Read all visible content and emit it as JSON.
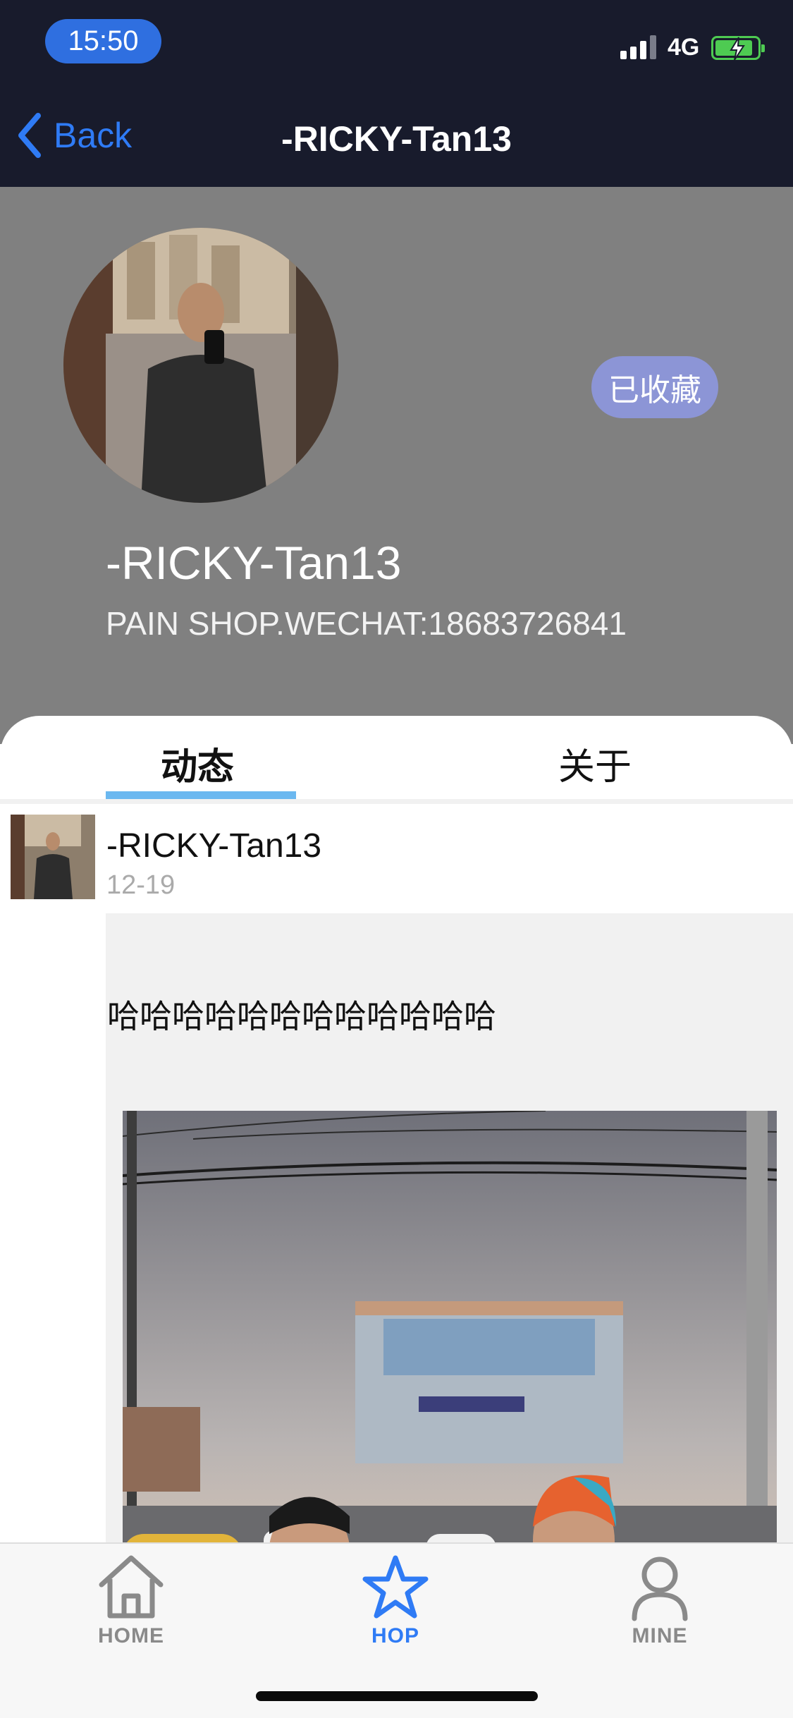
{
  "status_bar": {
    "time": "15:50",
    "network": "4G",
    "battery_color": "#4ecb52"
  },
  "nav": {
    "back_label": "Back",
    "title": "-RICKY-Tan13",
    "accent": "#2f7bf5"
  },
  "profile": {
    "name": "-RICKY-Tan13",
    "bio": "PAIN SHOP.WECHAT:18683726841",
    "favorite_button": "已收藏",
    "header_bg": "#808080"
  },
  "tabs": [
    {
      "label": "动态",
      "active": true
    },
    {
      "label": "关于",
      "active": false
    }
  ],
  "post": {
    "author": "-RICKY-Tan13",
    "date": "12-19",
    "text": "哈哈哈哈哈哈哈哈哈哈哈哈"
  },
  "tabbar": {
    "items": [
      {
        "label": "HOME",
        "icon": "house-icon",
        "active": false
      },
      {
        "label": "HOP",
        "icon": "star-icon",
        "active": true
      },
      {
        "label": "MINE",
        "icon": "person-icon",
        "active": false
      }
    ],
    "active_color": "#2f7bf5",
    "inactive_color": "#8a8a8a"
  }
}
